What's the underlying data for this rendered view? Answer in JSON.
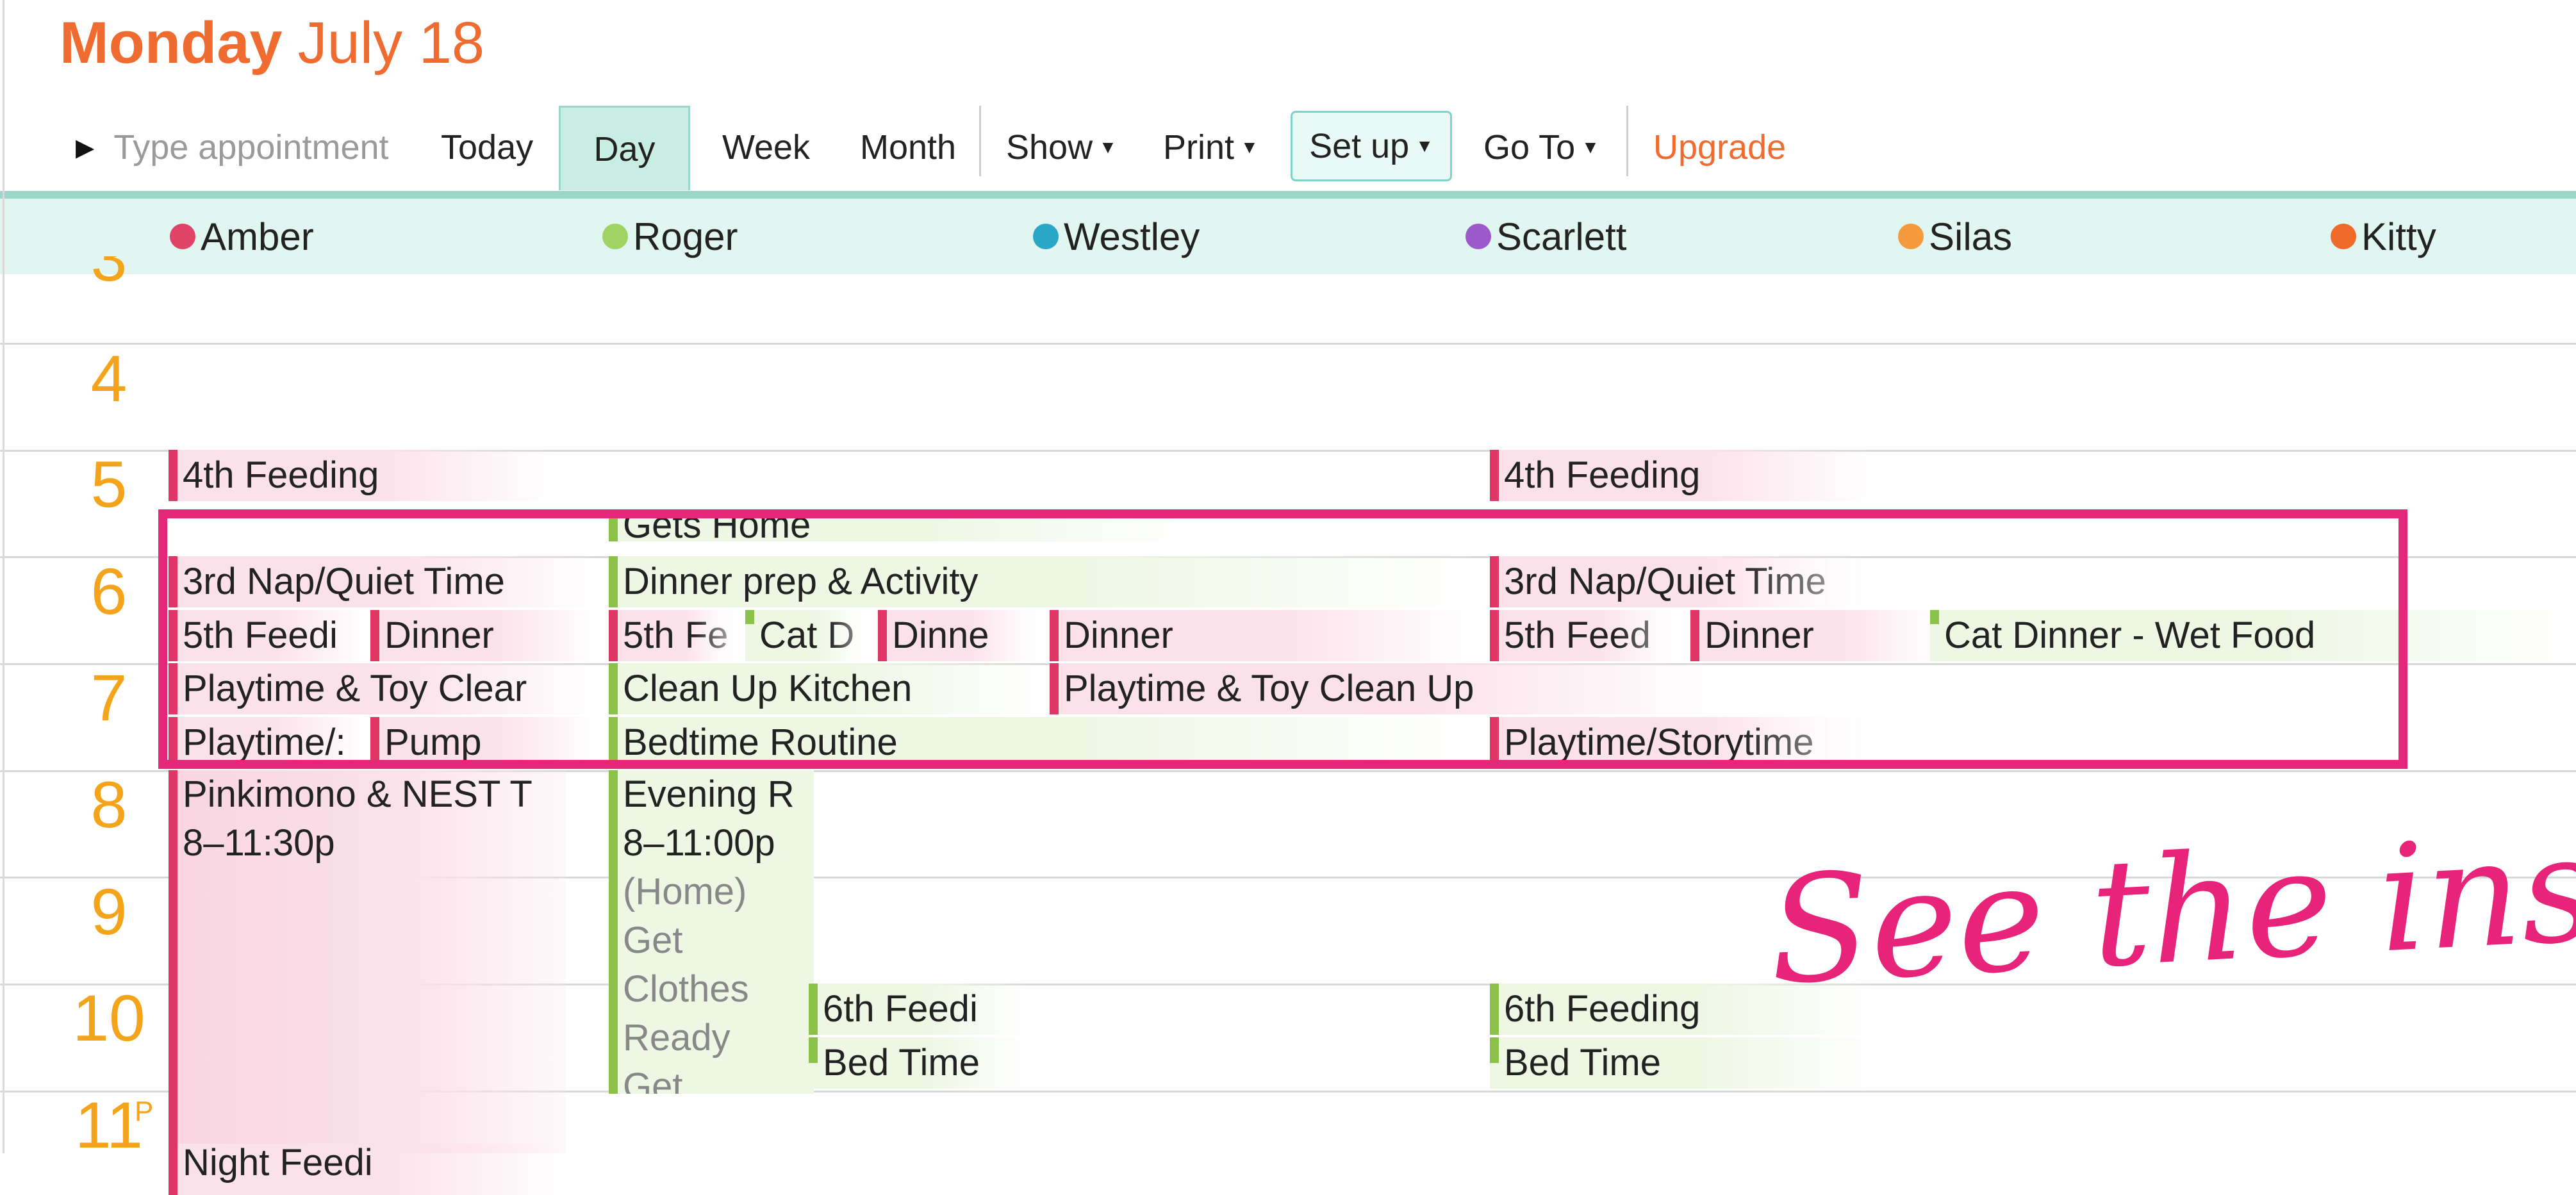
{
  "header": {
    "day": "Monday",
    "date": "July 18"
  },
  "toolbar": {
    "type_placeholder": "Type appointment",
    "today": "Today",
    "day": "Day",
    "week": "Week",
    "month": "Month",
    "show": "Show",
    "print": "Print",
    "setup": "Set up",
    "goto": "Go To",
    "upgrade": "Upgrade",
    "active_view": "Day"
  },
  "people": [
    {
      "name": "Amber",
      "color": "#e04367"
    },
    {
      "name": "Roger",
      "color": "#9ed464"
    },
    {
      "name": "Westley",
      "color": "#2aa7c7"
    },
    {
      "name": "Scarlett",
      "color": "#9b59c9"
    },
    {
      "name": "Silas",
      "color": "#f59b3f"
    },
    {
      "name": "Kitty",
      "color": "#f06a2a"
    }
  ],
  "hours": [
    "3",
    "4",
    "5",
    "6",
    "7",
    "8",
    "9",
    "10",
    "11"
  ],
  "hour_suffix": "P",
  "events": {
    "amber_4th_feeding": "4th Feeding",
    "scarlett_4th_feeding": "4th Feeding",
    "roger_gets_home": "Gets Home",
    "amber_3rd_nap": "3rd Nap/Quiet Time",
    "roger_dinner_prep": "Dinner prep & Activity",
    "scarlett_3rd_nap": "3rd Nap/Quiet Time",
    "amber_5th_feeding": "5th Feedi",
    "amber_dinner": "Dinner",
    "roger_5th_feeding": "5th Fe",
    "roger_cat_dinner": "Cat D",
    "roger_dinner": "Dinne",
    "westley_dinner": "Dinner",
    "scarlett_5th_feeding": "5th Feed",
    "scarlett_dinner": "Dinner",
    "kitty_cat_dinner": "Cat Dinner - Wet Food",
    "amber_playtime_cleanup": "Playtime & Toy Clear",
    "roger_clean_kitchen": "Clean Up Kitchen",
    "westley_playtime_cleanup": "Playtime & Toy Clean Up",
    "amber_playtime_story": "Playtime/:",
    "amber_pump": "Pump",
    "roger_bedtime_routine": "Bedtime Routine",
    "scarlett_playtime_story": "Playtime/Storytime",
    "amber_pinkimono": "Pinkimono & NEST T",
    "amber_pinkimono_time": "8–11:30p",
    "roger_evening": "Evening R",
    "roger_evening_time": "8–11:00p",
    "roger_evening_note": "(Home)",
    "roger_evening_l1": "Get",
    "roger_evening_l2": "Clothes",
    "roger_evening_l3": "Ready",
    "roger_evening_l4": "Get",
    "westley_6th_feeding": "6th Feedi",
    "westley_bed_time": "Bed Time",
    "scarlett_6th_feeding": "6th Feeding",
    "scarlett_bed_time": "Bed Time",
    "amber_night": "Night Feedi"
  },
  "annotation": "See the insanity!",
  "colors": {
    "accent": "#ef6b2f",
    "hour": "#f4a41a",
    "highlight": "#e5277a",
    "amber_event": "#df3665",
    "roger_event": "#8bc34a",
    "people_bar": "#e1f6f1"
  }
}
